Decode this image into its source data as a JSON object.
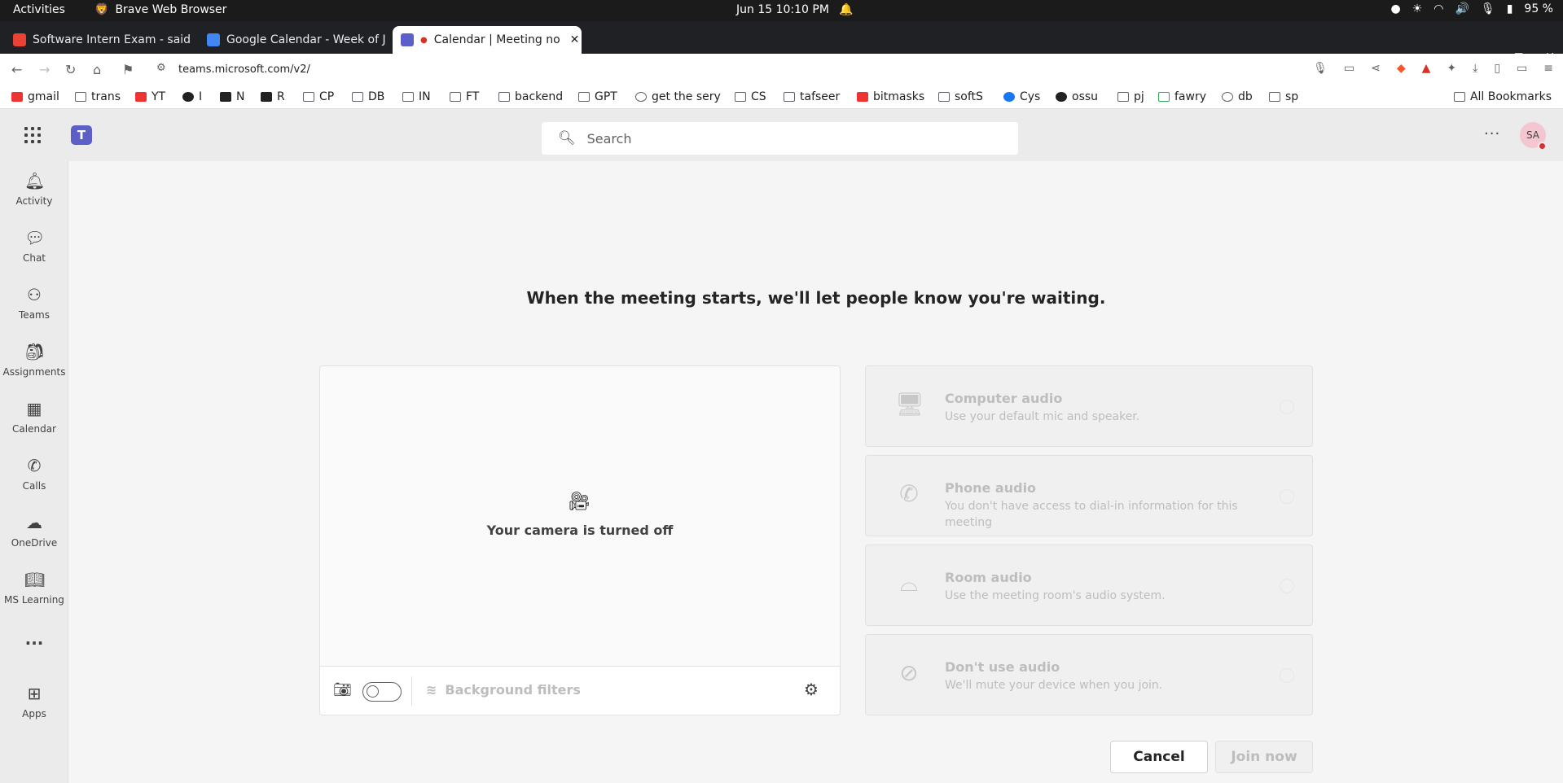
{
  "system": {
    "activities": "Activities",
    "app_name": "Brave Web Browser",
    "clock": "Jun 15  10:10 PM",
    "battery": "95 %"
  },
  "browser": {
    "tabs": [
      {
        "title": "Software Intern Exam - said",
        "favicon": "gmail-icon",
        "active": false
      },
      {
        "title": "Google Calendar - Week of J",
        "favicon": "calendar-icon",
        "active": false
      },
      {
        "title": "Calendar | Meeting no",
        "favicon": "teams-icon",
        "active": true
      }
    ],
    "url": "teams.microsoft.com/v2/",
    "bookmarks": [
      {
        "label": "gmail"
      },
      {
        "label": "trans"
      },
      {
        "label": "YT"
      },
      {
        "label": "I"
      },
      {
        "label": "N"
      },
      {
        "label": "R"
      },
      {
        "label": "CP"
      },
      {
        "label": "DB"
      },
      {
        "label": "IN"
      },
      {
        "label": "FT"
      },
      {
        "label": "backend"
      },
      {
        "label": "GPT"
      },
      {
        "label": "get the sery"
      },
      {
        "label": "CS"
      },
      {
        "label": "tafseer"
      },
      {
        "label": "bitmasks"
      },
      {
        "label": "softS"
      },
      {
        "label": "Cys"
      },
      {
        "label": "ossu"
      },
      {
        "label": "pj"
      },
      {
        "label": "fawry"
      },
      {
        "label": "db"
      },
      {
        "label": "sp"
      }
    ],
    "all_bookmarks": "All Bookmarks"
  },
  "header": {
    "search_placeholder": "Search",
    "avatar_initials": "SA"
  },
  "rail": {
    "items": [
      {
        "label": "Activity",
        "icon": "bell-icon"
      },
      {
        "label": "Chat",
        "icon": "chat-icon"
      },
      {
        "label": "Teams",
        "icon": "teams-icon"
      },
      {
        "label": "Assignments",
        "icon": "backpack-icon"
      },
      {
        "label": "Calendar",
        "icon": "calendar-icon"
      },
      {
        "label": "Calls",
        "icon": "phone-icon"
      },
      {
        "label": "OneDrive",
        "icon": "cloud-icon"
      },
      {
        "label": "MS Learning",
        "icon": "book-icon"
      },
      {
        "label": "Apps",
        "icon": "add-app-icon"
      }
    ]
  },
  "prejoin": {
    "title": "When the meeting starts, we'll let people know you're waiting.",
    "camera_off_text": "Your camera is turned off",
    "background_filters": "Background filters",
    "audio_options": [
      {
        "title": "Computer audio",
        "desc": "Use your default mic and speaker.",
        "icon": "computer-audio-icon"
      },
      {
        "title": "Phone audio",
        "desc": "You don't have access to dial-in information for this meeting",
        "icon": "phone-audio-icon"
      },
      {
        "title": "Room audio",
        "desc": "Use the meeting room's audio system.",
        "icon": "room-audio-icon"
      },
      {
        "title": "Don't use audio",
        "desc": "We'll mute your device when you join.",
        "icon": "no-audio-icon"
      }
    ],
    "cancel_label": "Cancel",
    "join_label": "Join now"
  }
}
